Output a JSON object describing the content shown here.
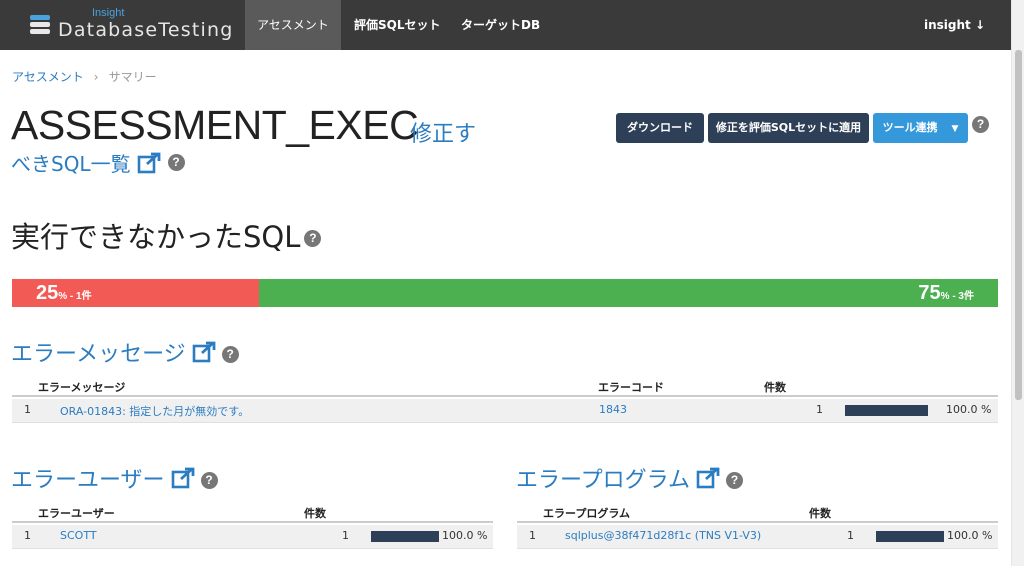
{
  "nav": {
    "logo_small": "Insight",
    "logo_big": "DatabaseTesting",
    "items": [
      {
        "label": "アセスメント"
      },
      {
        "label": "評価SQLセット"
      },
      {
        "label": "ターゲットDB"
      }
    ],
    "user": "insight ↓"
  },
  "breadcrumb": {
    "items": [
      "アセスメント",
      "サマリー"
    ],
    "separator": "›"
  },
  "header": {
    "title": "ASSESSMENT_EXEC",
    "link1": "修正す",
    "link2": "べきSQL一覧",
    "help": "?"
  },
  "buttons": {
    "download": "ダウンロード",
    "apply": "修正を評価SQLセットに適用",
    "tools": "ツール連携",
    "tools_caret": "▼"
  },
  "failed_section": {
    "title": "実行できなかったSQL"
  },
  "progress": {
    "fail_percent": 25,
    "fail_value": "25",
    "fail_suffix": "% - 1件",
    "pass_percent": 75,
    "pass_value": "75",
    "pass_suffix": "% - 3件",
    "fail_color": "#f25a55",
    "pass_color": "#4caf50"
  },
  "error_messages": {
    "title": "エラーメッセージ",
    "columns": [
      "エラーメッセージ",
      "エラーコード",
      "件数"
    ],
    "rows": [
      {
        "index": "1",
        "message": "ORA-01843: 指定した月が無効です。",
        "code": "1843",
        "count": "1",
        "ratio": 1.0,
        "percent": "100.0 %"
      }
    ]
  },
  "error_users": {
    "title": "エラーユーザー",
    "columns": [
      "エラーユーザー",
      "件数"
    ],
    "rows": [
      {
        "index": "1",
        "user": "SCOTT",
        "count": "1",
        "ratio": 1.0,
        "percent": "100.0 %"
      }
    ]
  },
  "error_programs": {
    "title": "エラープログラム",
    "columns": [
      "エラープログラム",
      "件数"
    ],
    "rows": [
      {
        "index": "1",
        "program": "sqlplus@38f471d28f1c (TNS V1-V3)",
        "count": "1",
        "ratio": 1.0,
        "percent": "100.0 %"
      }
    ]
  },
  "colors": {
    "accent": "#2b7cc1",
    "navbar": "#3a3a3a",
    "dark_button": "#2e4057",
    "blue_button": "#3498db"
  }
}
